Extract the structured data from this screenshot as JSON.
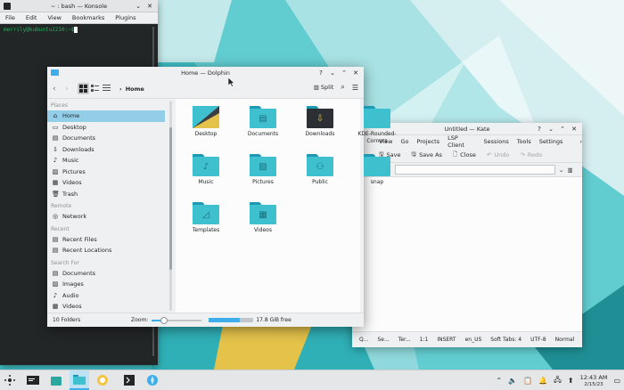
{
  "colors": {
    "accent": "#3daee9",
    "wallpaper_teal": "#3fbfc4",
    "wallpaper_yellow": "#e5c34a",
    "terminal_green": "#27ae60"
  },
  "konsole": {
    "title": "~ : bash — Konsole",
    "menu": [
      "File",
      "Edit",
      "View",
      "Bookmarks",
      "Plugins"
    ],
    "prompt": "merrily@kubuntu2210:~$"
  },
  "kate": {
    "title": "Untitled — Kate",
    "menu": [
      "View",
      "Go",
      "Projects",
      "LSP Client",
      "Sessions",
      "Tools",
      "Settings"
    ],
    "toolbar": {
      "save": "Save",
      "save_as": "Save As",
      "close": "Close",
      "undo": "Undo",
      "redo": "Redo"
    },
    "tab_label": "ntitled",
    "status": [
      "Q...",
      "Se...",
      "Ter...",
      "1:1",
      "INSERT",
      "en_US",
      "Soft Tabs: 4",
      "UTF-8",
      "Normal"
    ]
  },
  "dolphin": {
    "title": "Home — Dolphin",
    "breadcrumb": "Home",
    "split_label": "Split",
    "places": {
      "sections": {
        "places": "Places",
        "remote": "Remote",
        "recent": "Recent",
        "search": "Search For"
      },
      "places_items": [
        {
          "label": "Home",
          "icon": "home-icon"
        },
        {
          "label": "Desktop",
          "icon": "desktop-icon"
        },
        {
          "label": "Documents",
          "icon": "documents-icon"
        },
        {
          "label": "Downloads",
          "icon": "downloads-icon"
        },
        {
          "label": "Music",
          "icon": "music-icon"
        },
        {
          "label": "Pictures",
          "icon": "pictures-icon"
        },
        {
          "label": "Videos",
          "icon": "videos-icon"
        },
        {
          "label": "Trash",
          "icon": "trash-icon"
        }
      ],
      "remote_items": [
        {
          "label": "Network",
          "icon": "network-icon"
        }
      ],
      "recent_items": [
        {
          "label": "Recent Files",
          "icon": "recent-files-icon"
        },
        {
          "label": "Recent Locations",
          "icon": "recent-locations-icon"
        }
      ],
      "search_items": [
        {
          "label": "Documents",
          "icon": "documents-icon"
        },
        {
          "label": "Images",
          "icon": "images-icon"
        },
        {
          "label": "Audio",
          "icon": "audio-icon"
        },
        {
          "label": "Videos",
          "icon": "videos-icon"
        }
      ]
    },
    "files": [
      {
        "label": "Desktop",
        "icon": "desktop-folder-icon"
      },
      {
        "label": "Documents",
        "icon": "documents-folder-icon"
      },
      {
        "label": "Downloads",
        "icon": "downloads-folder-icon"
      },
      {
        "label": "KDE-Rounded-Corners",
        "icon": "folder-icon"
      },
      {
        "label": "Music",
        "icon": "music-folder-icon"
      },
      {
        "label": "Pictures",
        "icon": "pictures-folder-icon"
      },
      {
        "label": "Public",
        "icon": "public-folder-icon"
      },
      {
        "label": "snap",
        "icon": "folder-icon"
      },
      {
        "label": "Templates",
        "icon": "templates-folder-icon"
      },
      {
        "label": "Videos",
        "icon": "videos-folder-icon"
      }
    ],
    "status_count": "10 Folders",
    "zoom_label": "Zoom:",
    "free_space": "17.8 GiB free",
    "zoom_fraction": 0.25,
    "disk_used_fraction": 0.7
  },
  "taskbar": {
    "clock_time": "12:43 AM",
    "clock_date": "2/15/23"
  }
}
